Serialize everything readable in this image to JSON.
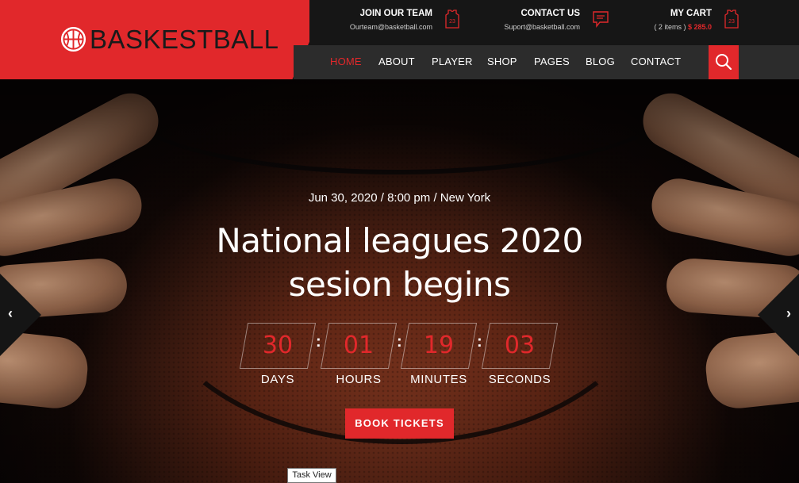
{
  "brand": {
    "name": "BASKESTBALL",
    "accent": "#e1282b",
    "dark": "#161616"
  },
  "topbar": {
    "team": {
      "title": "JOIN OUR TEAM",
      "sub": "Ourteam@basketball.com",
      "icon": "jersey-icon"
    },
    "contact": {
      "title": "CONTACT US",
      "sub": "Suport@basketball.com",
      "icon": "chat-icon"
    },
    "cart": {
      "title": "MY CART",
      "items": "( 2 items )",
      "price": "$ 285.0",
      "icon": "jersey-icon"
    }
  },
  "nav": {
    "items": [
      "HOME",
      "ABOUT",
      "PLAYER",
      "SHOP",
      "PAGES",
      "BLOG",
      "CONTACT"
    ],
    "active": "HOME",
    "search_icon": "search-icon"
  },
  "hero": {
    "date": "Jun 30, 2020 / 8:00 pm / New York",
    "title_line1": "National leagues 2020",
    "title_line2": "sesion begins",
    "countdown": [
      {
        "value": "30",
        "label": "DAYS"
      },
      {
        "value": "01",
        "label": "HOURS"
      },
      {
        "value": "19",
        "label": "MINUTES"
      },
      {
        "value": "03",
        "label": "SECONDS"
      }
    ],
    "button": "BOOK TICKETS",
    "prev_arrow": "‹",
    "next_arrow": "›"
  },
  "tooltip": "Task View"
}
